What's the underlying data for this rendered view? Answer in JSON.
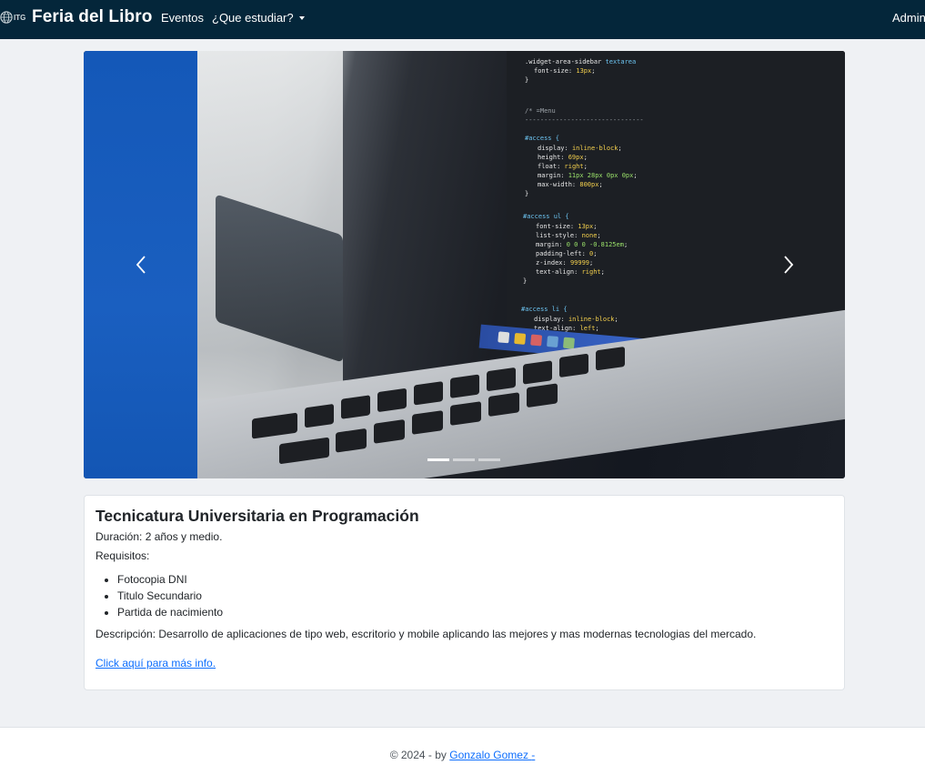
{
  "navbar": {
    "logo_text": "ITG",
    "brand": "Feria del Libro",
    "links": [
      {
        "label": "Eventos"
      },
      {
        "label": "¿Que estudiar?"
      }
    ],
    "admin_label": "Admin"
  },
  "carousel": {
    "slide_count": 3,
    "active_index": 0,
    "icons": {
      "prev": "chevron-left-icon",
      "next": "chevron-right-icon"
    }
  },
  "career": {
    "title": "Tecnicatura Universitaria en Programación",
    "duration": "Duración: 2 años y medio.",
    "requirements_label": "Requisitos:",
    "requirements": [
      "Fotocopia DNI",
      "Titulo Secundario",
      "Partida de nacimiento"
    ],
    "description": "Descripción: Desarrollo de aplicaciones de tipo web, escritorio y mobile aplicando las mejores y mas modernas tecnologias del mercado.",
    "more_info_link": "Click aquí para más info."
  },
  "footer": {
    "prefix": "© 2024 - by ",
    "author": "Gonzalo Gomez ",
    "suffix": "-"
  },
  "colors": {
    "navbar_bg": "#04263a",
    "page_bg": "#eff1f4",
    "accent_blue": "#1458b8",
    "link": "#0d6efd"
  }
}
